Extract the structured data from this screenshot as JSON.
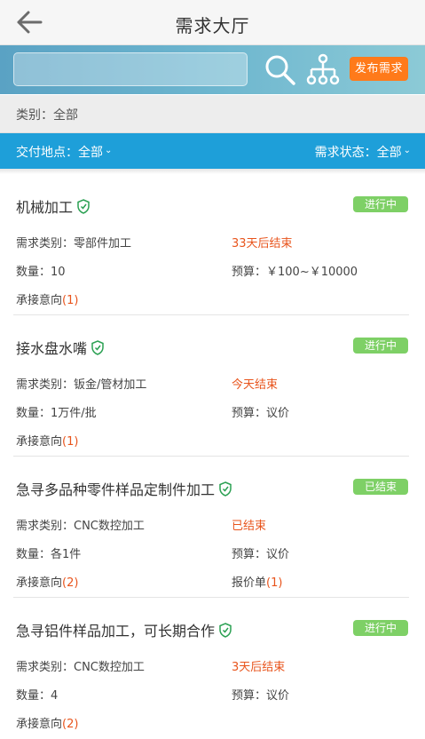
{
  "header": {
    "title": "需求大厅"
  },
  "search": {
    "value": "",
    "placeholder": "",
    "publish_label": "发布需求"
  },
  "category": {
    "text": "类别：全部"
  },
  "filters": {
    "location": "交付地点：全部",
    "status": "需求状态：全部"
  },
  "labels": {
    "quantity_prefix": "数量：",
    "intent_prefix": "承接意向",
    "quote_prefix": "报价单"
  },
  "colors": {
    "accent_blue": "#1e9fd9",
    "orange": "#ff7a1a",
    "badge_green": "#7ed066",
    "deadline_red": "#e8541c"
  },
  "items": [
    {
      "title": "机械加工",
      "status": "进行中",
      "category": "需求类别：零部件加工",
      "deadline": "33天后结束",
      "quantity": "数量：10",
      "budget": "预算：￥100~￥10000",
      "intent": "承接意向",
      "intent_count": "(1)"
    },
    {
      "title": "接水盘水嘴",
      "status": "进行中",
      "category": "需求类别：钣金/管材加工",
      "deadline": "今天结束",
      "quantity": "数量：1万件/批",
      "budget": "预算：议价",
      "intent": "承接意向",
      "intent_count": "(1)"
    },
    {
      "title": "急寻多品种零件样品定制件加工",
      "status": "已结束",
      "category": "需求类别：CNC数控加工",
      "deadline": "已结束",
      "quantity": "数量：各1件",
      "budget": "预算：议价",
      "intent": "承接意向",
      "intent_count": "(2)",
      "quote": "报价单",
      "quote_count": "(1)"
    },
    {
      "title": "急寻铝件样品加工，可长期合作",
      "status": "进行中",
      "category": "需求类别：CNC数控加工",
      "deadline": "3天后结束",
      "quantity": "数量：4",
      "budget": "预算：议价",
      "intent": "承接意向",
      "intent_count": "(2)"
    }
  ]
}
